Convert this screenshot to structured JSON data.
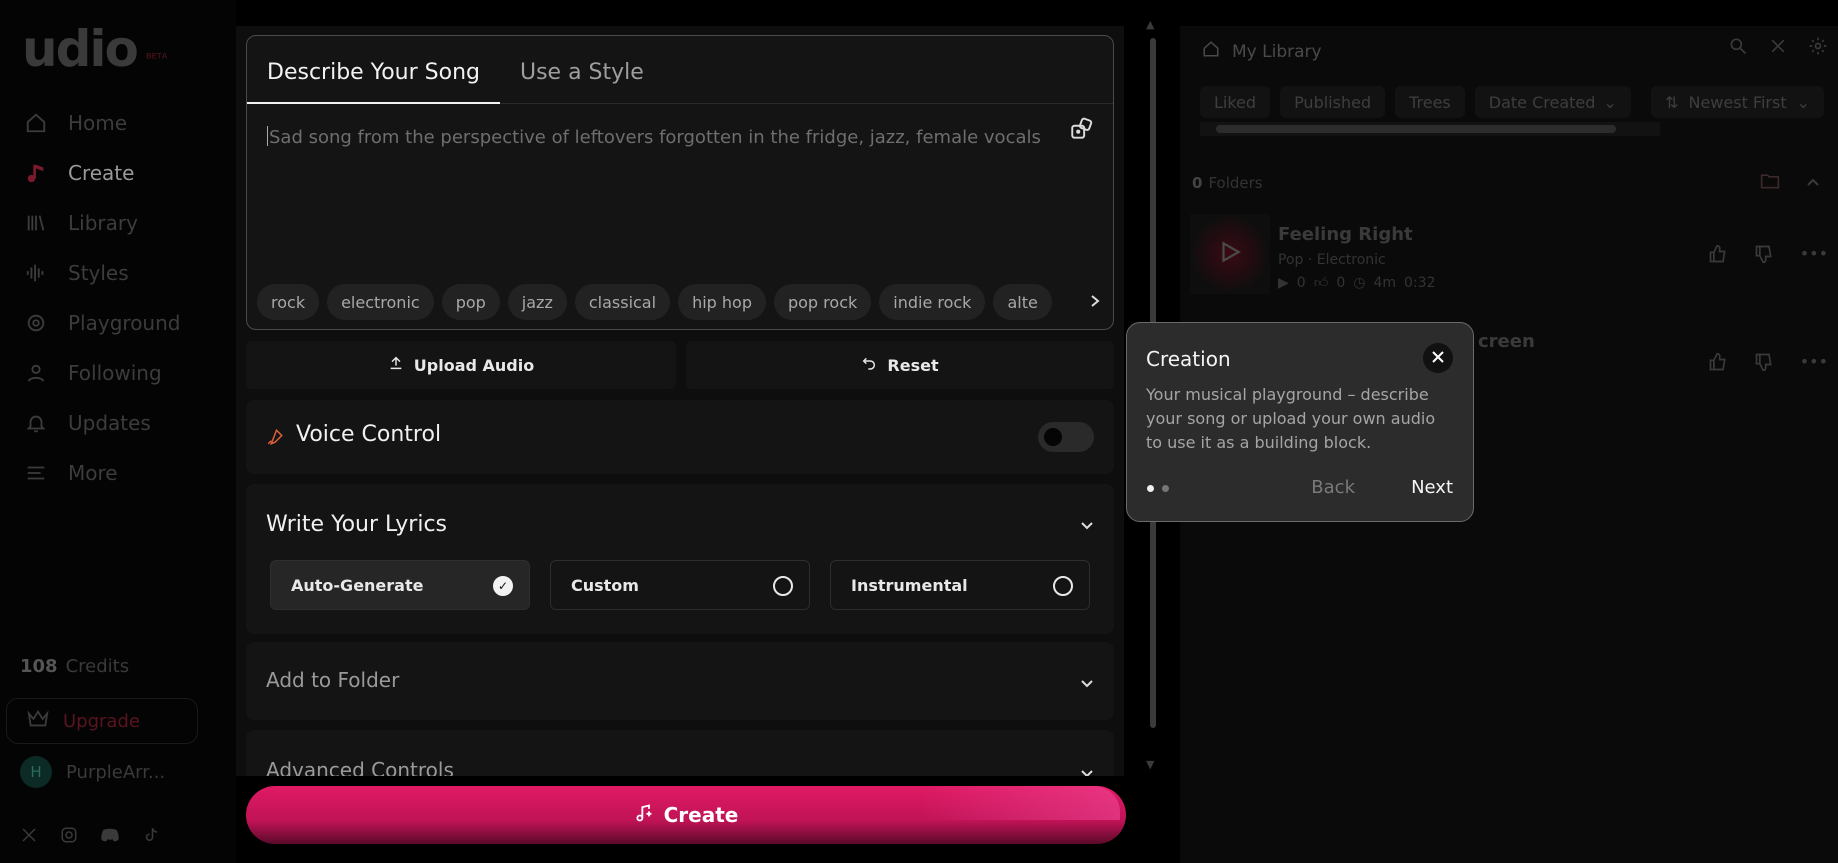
{
  "sidebar": {
    "logo": "udio",
    "logo_badge": "ᴮᴱᵀᴬ",
    "nav": [
      {
        "label": "Home",
        "icon": "home-icon"
      },
      {
        "label": "Create",
        "icon": "music-note-icon",
        "active": true
      },
      {
        "label": "Library",
        "icon": "library-icon"
      },
      {
        "label": "Styles",
        "icon": "waveform-icon"
      },
      {
        "label": "Playground",
        "icon": "playground-icon"
      },
      {
        "label": "Following",
        "icon": "user-icon"
      },
      {
        "label": "Updates",
        "icon": "bell-icon"
      },
      {
        "label": "More",
        "icon": "menu-icon"
      }
    ],
    "credits_count": "108",
    "credits_label": "Credits",
    "upgrade_label": "Upgrade",
    "user_initial": "H",
    "user_name": "PurpleArr..."
  },
  "prompt": {
    "tabs": [
      "Describe Your Song",
      "Use a Style"
    ],
    "active_tab": 0,
    "placeholder": "Sad song from the perspective of leftovers forgotten in the fridge, jazz, female vocals",
    "chips": [
      "rock",
      "electronic",
      "pop",
      "jazz",
      "classical",
      "hip hop",
      "pop rock",
      "indie rock",
      "alte"
    ]
  },
  "actions": {
    "upload_label": "Upload Audio",
    "reset_label": "Reset"
  },
  "voice_control": {
    "title": "Voice Control",
    "enabled": false
  },
  "lyrics": {
    "title": "Write Your Lyrics",
    "options": [
      {
        "label": "Auto-Generate",
        "selected": true
      },
      {
        "label": "Custom",
        "selected": false
      },
      {
        "label": "Instrumental",
        "selected": false
      }
    ]
  },
  "folder": {
    "title": "Add to Folder"
  },
  "advanced": {
    "title": "Advanced Controls"
  },
  "create_button": {
    "label": "Create"
  },
  "library": {
    "title": "My Library",
    "filters": [
      "Liked",
      "Published",
      "Trees",
      "Date Created"
    ],
    "sort": "Newest First",
    "folders_count": "0",
    "folders_label": "Folders",
    "tracks": [
      {
        "title": "Feeling Right",
        "tags": "Pop · Electronic",
        "plays": "0",
        "likes": "0",
        "age": "4m",
        "duration": "0:32"
      }
    ],
    "partial_title": "creen"
  },
  "tooltip": {
    "title": "Creation",
    "body": "Your musical playground – describe your song or upload your own audio to use it as a building block.",
    "back_label": "Back",
    "next_label": "Next",
    "step": 1,
    "steps": 2
  }
}
